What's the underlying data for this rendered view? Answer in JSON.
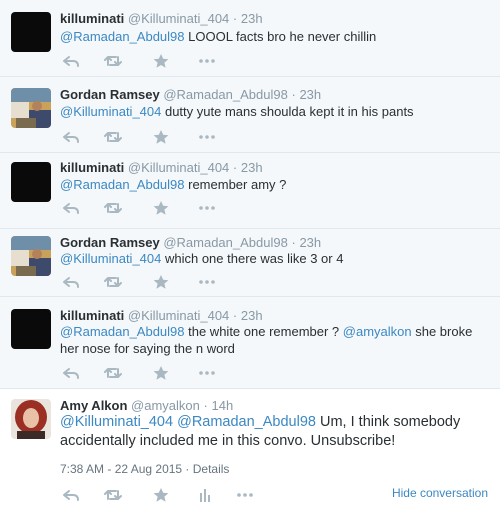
{
  "tweets": [
    {
      "name": "killuminati",
      "handle": "@Killuminati_404",
      "sep": "·",
      "time": "23h",
      "mention": "@Ramadan_Abdul98",
      "text": " LOOOL facts bro he never chillin"
    },
    {
      "name": "Gordan Ramsey",
      "handle": "@Ramadan_Abdul98",
      "sep": "·",
      "time": "23h",
      "mention": "@Killuminati_404",
      "text": " dutty yute mans shoulda kept it in his pants"
    },
    {
      "name": "killuminati",
      "handle": "@Killuminati_404",
      "sep": "·",
      "time": "23h",
      "mention": "@Ramadan_Abdul98",
      "text": " remember amy ?"
    },
    {
      "name": "Gordan Ramsey",
      "handle": "@Ramadan_Abdul98",
      "sep": "·",
      "time": "23h",
      "mention": "@Killuminati_404",
      "text": " which one there was like 3 or 4"
    },
    {
      "name": "killuminati",
      "handle": "@Killuminati_404",
      "sep": "·",
      "time": "23h",
      "mention": "@Ramadan_Abdul98",
      "text": " the white one remember ? ",
      "mention2": "@amyalkon",
      "text2": " she broke her nose for saying the n word"
    }
  ],
  "focus": {
    "name": "Amy Alkon",
    "handle": "@amyalkon",
    "sep": "·",
    "time": "14h",
    "mention": "@Killuminati_404",
    "mention2": "@Ramadan_Abdul98",
    "text": " Um, I think somebody accidentally included me in this convo. Unsubscribe!",
    "details": "7:38 AM - 22 Aug 2015 · Details",
    "hide": "Hide conversation"
  },
  "icons": {
    "reply": "reply-icon",
    "retweet": "retweet-icon",
    "favorite": "star-icon",
    "more": "more-icon",
    "analytics": "analytics-icon"
  },
  "colors": {
    "link": "#3b88c3",
    "muted": "#8899a6",
    "icon": "#aab8c2",
    "background": "#f5f8fa",
    "focus_background": "#ffffff"
  }
}
